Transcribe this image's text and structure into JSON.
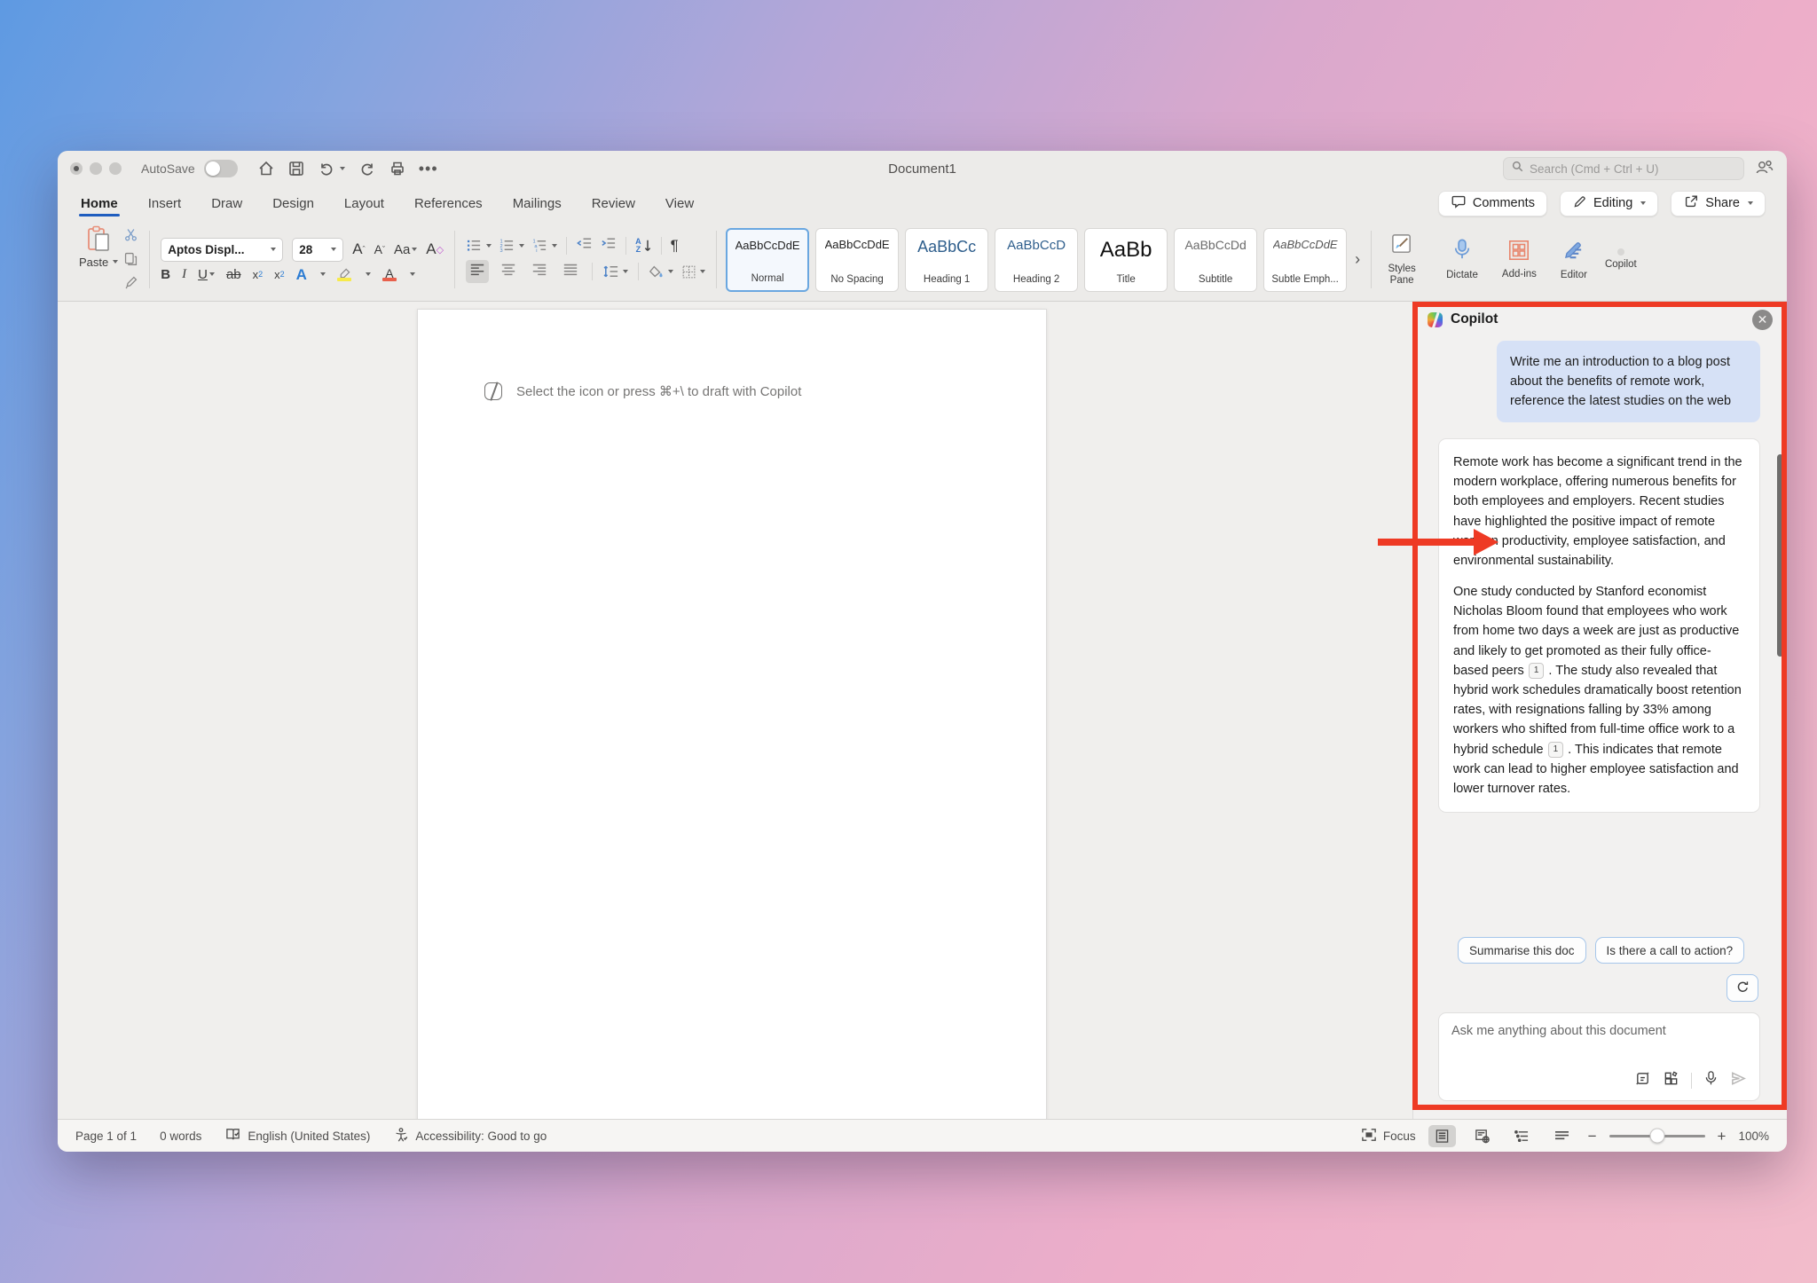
{
  "colors": {
    "annotation_red": "#EE3A24",
    "bubble_blue": "#D6E1F6",
    "accent_blue": "#2B7CD3"
  },
  "titlebar": {
    "autosave": "AutoSave",
    "title": "Document1",
    "search_placeholder": "Search (Cmd + Ctrl + U)"
  },
  "tabs": [
    "Home",
    "Insert",
    "Draw",
    "Design",
    "Layout",
    "References",
    "Mailings",
    "Review",
    "View"
  ],
  "top_actions": {
    "comments": "Comments",
    "editing": "Editing",
    "share": "Share"
  },
  "ribbon": {
    "paste": "Paste",
    "font_name": "Aptos Displ...",
    "font_size": "28",
    "bold": "B",
    "italic": "I",
    "underline": "U",
    "strike": "ab",
    "sub_base": "x",
    "sub": "2",
    "sup_base": "x",
    "sup": "2",
    "case": "Aa",
    "effects": "A",
    "fontcolor": "A",
    "sort_a": "A",
    "sort_z": "Z",
    "pilcrow": "¶",
    "expander": "›",
    "styles": [
      {
        "preview": "AaBbCcDdE",
        "label": "Normal"
      },
      {
        "preview": "AaBbCcDdE",
        "label": "No Spacing"
      },
      {
        "preview": "AaBbCc",
        "label": "Heading 1"
      },
      {
        "preview": "AaBbCcD",
        "label": "Heading 2"
      },
      {
        "preview": "AaBb",
        "label": "Title"
      },
      {
        "preview": "AaBbCcDd",
        "label": "Subtitle"
      },
      {
        "preview": "AaBbCcDdE",
        "label": "Subtle Emph..."
      }
    ],
    "panel_buttons": {
      "styles_pane": "Styles Pane",
      "dictate": "Dictate",
      "addins": "Add-ins",
      "editor": "Editor",
      "copilot": "Copilot"
    }
  },
  "document": {
    "hint": "Select the icon or press ⌘+\\ to draft with Copilot"
  },
  "copilot": {
    "title": "Copilot",
    "close": "✕",
    "user_prompt": "Write me an introduction to a blog post about the benefits of remote work, reference the latest studies on the web",
    "response": {
      "p1": "Remote work has become a significant trend in the modern workplace, offering numerous benefits for both employees and employers. Recent studies have highlighted the positive impact of remote work on productivity, employee satisfaction, and environmental sustainability.",
      "p2a": "One study conducted by Stanford economist Nicholas Bloom found that employees who work from home two days a week are just as productive and likely to get promoted as their fully office-based peers ",
      "cite": "1",
      "p2b": " . The study also revealed that hybrid work schedules dramatically boost retention rates, with resignations falling by 33% among workers who shifted from full-time office work to a hybrid schedule ",
      "p2c": " . This indicates that remote work can lead to higher employee satisfaction and lower turnover rates."
    },
    "suggestions": [
      "Summarise this doc",
      "Is there a call to action?"
    ],
    "input_placeholder": "Ask me anything about this document"
  },
  "statusbar": {
    "page": "Page 1 of 1",
    "words": "0 words",
    "language": "English (United States)",
    "accessibility": "Accessibility: Good to go",
    "focus": "Focus",
    "zoom": "100%"
  }
}
